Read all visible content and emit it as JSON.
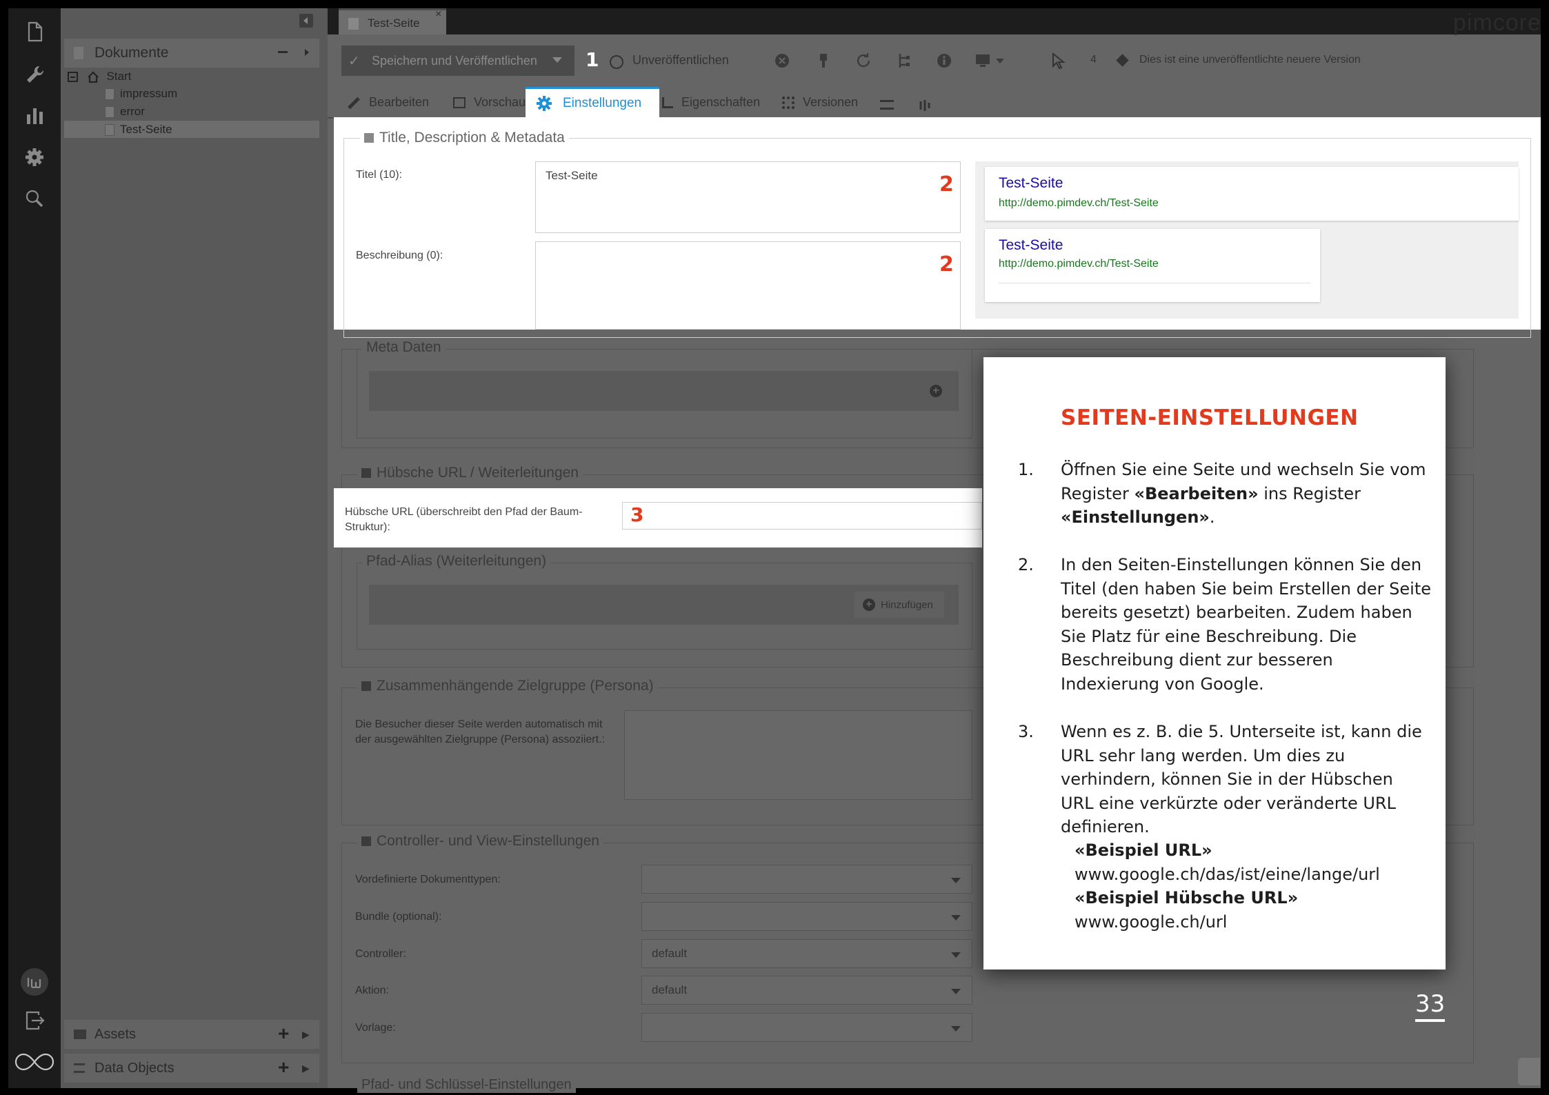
{
  "leftbar": {
    "icons": [
      "document-icon",
      "wrench-icon",
      "bar-chart-icon",
      "gear-icon",
      "search-icon"
    ],
    "bottom_icons": [
      "iw-logo-icon",
      "logout-icon",
      "infinity-logo-icon"
    ]
  },
  "tree": {
    "header": "Dokumente",
    "root": "Start",
    "items": [
      "impressum",
      "error",
      "Test-Seite"
    ],
    "sections": [
      "Assets",
      "Data Objects"
    ]
  },
  "editor": {
    "document_tab": "Test-Seite",
    "brand": "pimcore",
    "toolbar": {
      "save_publish": "Speichern und Veröffentlichen",
      "unpublish": "Unveröffentlichen",
      "version_count": "4",
      "version_note": "Dies ist eine unveröffentlichte neuere Version"
    },
    "tabs": [
      "Bearbeiten",
      "Vorschau",
      "Einstellungen",
      "Eigenschaften",
      "Versionen"
    ]
  },
  "settings": {
    "meta_section": "Title, Description & Metadata",
    "title_label": "Titel (10):",
    "title_value": "Test-Seite",
    "description_label": "Beschreibung (0):",
    "preview": {
      "title": "Test-Seite",
      "url": "http://demo.pimdev.ch/Test-Seite"
    },
    "meta_data": "Meta Daten",
    "pretty_url_section": "Hübsche URL / Weiterleitungen",
    "pretty_url_label": "Hübsche URL (überschreibt den Pfad der Baum-Struktur):",
    "path_alias": "Pfad-Alias (Weiterleitungen)",
    "add_button": "Hinzufügen",
    "persona_section": "Zusammenhängende Zielgruppe (Persona)",
    "persona_label": "Die Besucher dieser Seite werden automatisch mit der ausgewählten Zielgruppe (Persona) assoziiert.:",
    "controller_section": "Controller- und View-Einstellungen",
    "predefined_label": "Vordefinierte Dokumenttypen:",
    "bundle_label": "Bundle (optional):",
    "controller_label": "Controller:",
    "controller_value": "default",
    "action_label": "Aktion:",
    "action_value": "default",
    "template_label": "Vorlage:",
    "path_key_section": "Pfad- und Schlüssel-Einstellungen"
  },
  "markers": {
    "m1": "1",
    "m2": "2",
    "m3": "3"
  },
  "info_box": {
    "title": "SEITEN-EINSTELLUNGEN",
    "step1_num": "1.",
    "step1_a": "Öffnen Sie eine Seite und wechseln Sie vom Register ",
    "step1_b": "«Bearbeiten»",
    "step1_c": " ins Register ",
    "step1_d": "«Einstellungen»",
    "step1_e": ".",
    "step2_num": "2.",
    "step2": "In den Seiten-Einstellungen können Sie den Titel (den haben Sie beim Erstellen der Seite bereits gesetzt) bearbeiten. Zudem haben Sie Platz für eine Beschreibung. Die Beschreibung dient zur besseren Indexierung von Google.",
    "step3_num": "3.",
    "step3": "Wenn es z. B. die 5. Unterseite ist, kann die URL sehr lang werden. Um dies zu verhindern, können Sie in der Hübschen URL eine verkürzte oder veränderte URL definieren.",
    "example_label": "«Beispiel URL»",
    "example_url": "www.google.ch/das/ist/eine/lange/url",
    "pretty_label": "«Beispiel Hübsche URL»",
    "pretty_url": "www.google.ch/url"
  },
  "page_number": "33",
  "colors": {
    "accent_red": "#e23a1d",
    "tab_blue": "#1f8fd6",
    "link_blue": "#1a0dab",
    "url_green": "#16781a"
  }
}
